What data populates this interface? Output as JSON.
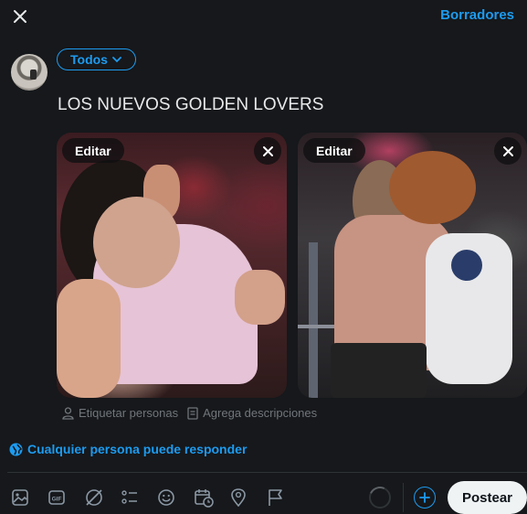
{
  "header": {
    "close_icon": "close-icon",
    "drafts_label": "Borradores"
  },
  "composer": {
    "audience_label": "Todos",
    "text": "LOS NUEVOS GOLDEN LOVERS"
  },
  "media": [
    {
      "edit_label": "Editar"
    },
    {
      "edit_label": "Editar"
    }
  ],
  "media_actions": {
    "tag_label": "Etiquetar personas",
    "desc_label": "Agrega descripciones"
  },
  "reply_setting": {
    "label": "Cualquier persona puede responder"
  },
  "toolbar": {
    "icons": [
      "image-icon",
      "gif-icon",
      "grok-icon",
      "poll-icon",
      "emoji-icon",
      "schedule-icon",
      "location-icon",
      "flag-icon"
    ],
    "post_label": "Postear"
  },
  "colors": {
    "accent": "#1d9bf0",
    "background": "#16181b",
    "post_button": "#eff3f4"
  }
}
